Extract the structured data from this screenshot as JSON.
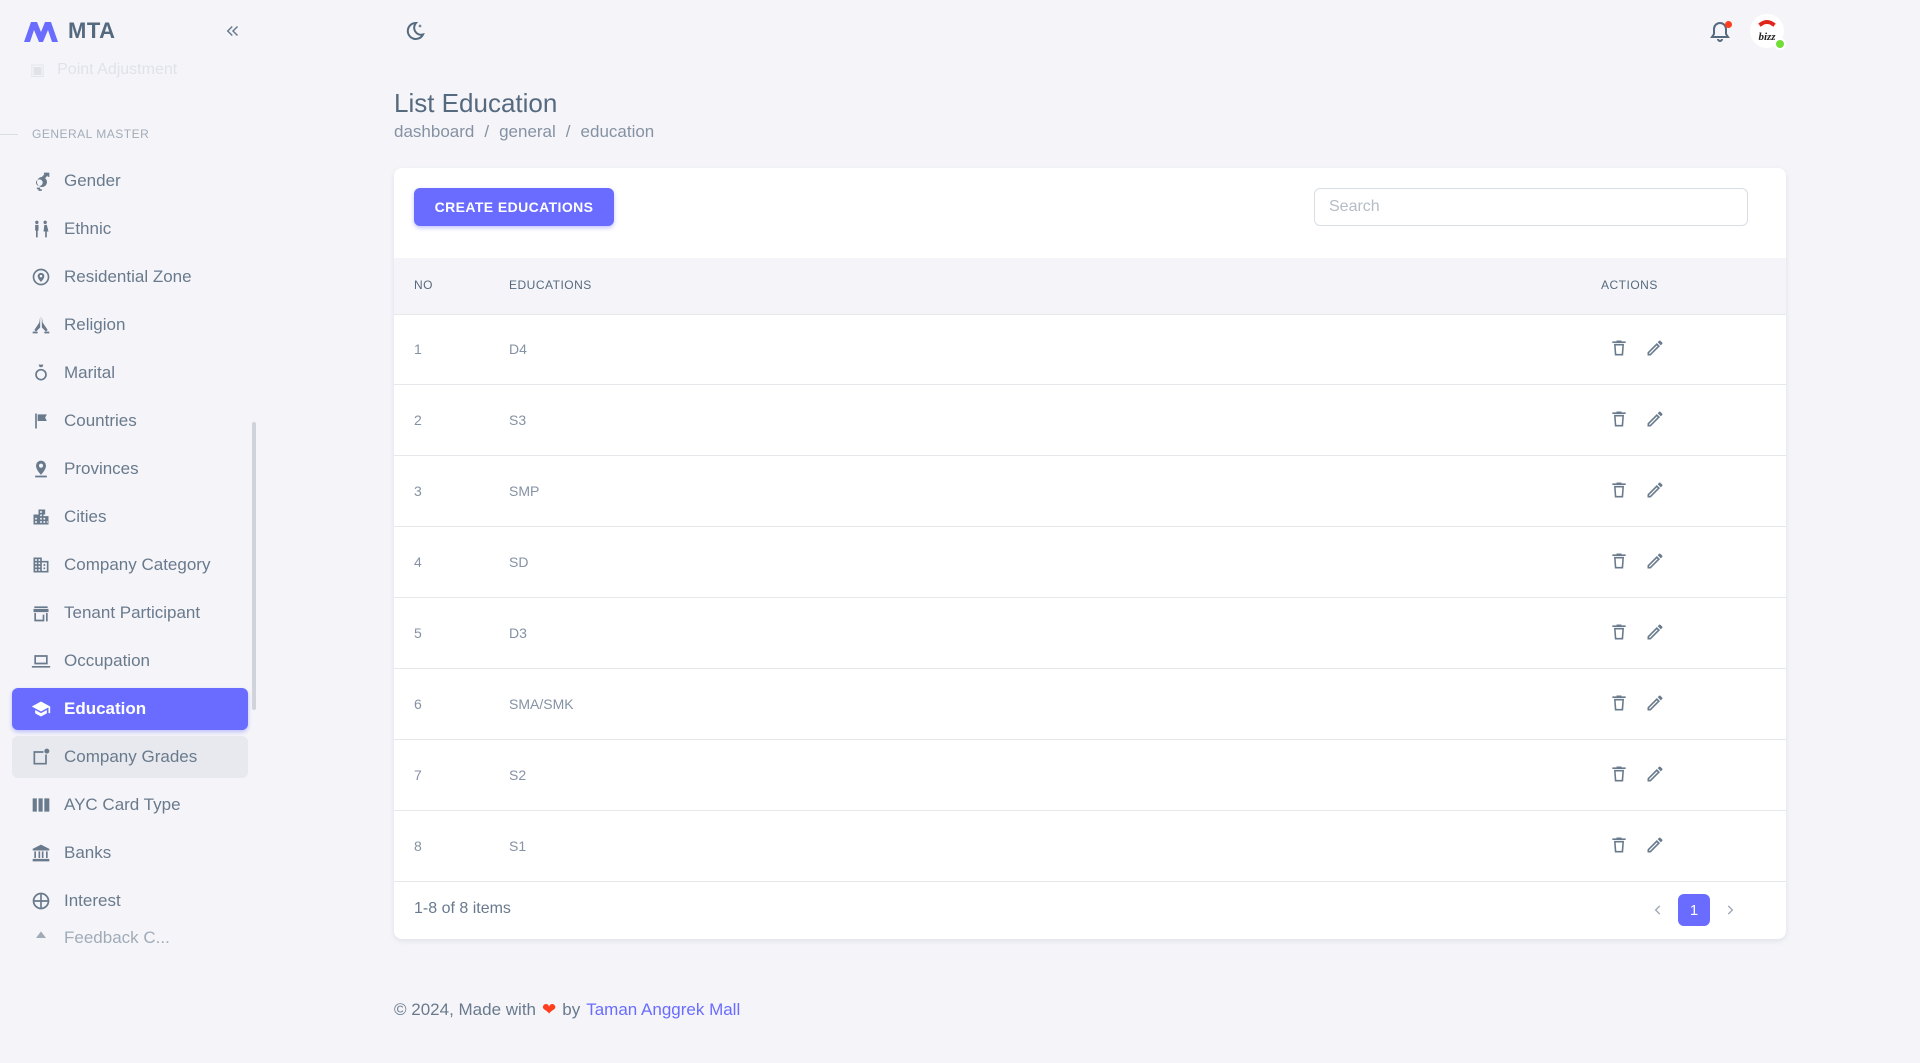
{
  "app": {
    "name": "MTA",
    "brand_color": "#696cff"
  },
  "sidebar": {
    "faded_item": "Point Adjustment",
    "section": "GENERAL MASTER",
    "items": [
      {
        "label": "Gender",
        "icon": "gender-icon"
      },
      {
        "label": "Ethnic",
        "icon": "people-icon"
      },
      {
        "label": "Residential Zone",
        "icon": "map-pin-circle-icon"
      },
      {
        "label": "Religion",
        "icon": "praying-hands-icon"
      },
      {
        "label": "Marital",
        "icon": "ring-icon"
      },
      {
        "label": "Countries",
        "icon": "flag-icon"
      },
      {
        "label": "Provinces",
        "icon": "location-pin-icon"
      },
      {
        "label": "Cities",
        "icon": "city-icon"
      },
      {
        "label": "Company Category",
        "icon": "building-icon"
      },
      {
        "label": "Tenant Participant",
        "icon": "store-icon"
      },
      {
        "label": "Occupation",
        "icon": "laptop-icon"
      },
      {
        "label": "Education",
        "icon": "graduation-cap-icon",
        "active": true
      },
      {
        "label": "Company Grades",
        "icon": "badge-notification-icon"
      },
      {
        "label": "AYC Card Type",
        "icon": "cards-icon"
      },
      {
        "label": "Banks",
        "icon": "bank-icon"
      },
      {
        "label": "Interest",
        "icon": "basketball-icon"
      }
    ],
    "cut_item": "Feedback C..."
  },
  "topbar": {
    "theme_icon": "moon-icon",
    "bell_icon": "bell-icon",
    "avatar_text": "bizz"
  },
  "page": {
    "title": "List Education",
    "breadcrumb": [
      "dashboard",
      "general",
      "education"
    ]
  },
  "card": {
    "create_label": "CREATE EDUCATIONS",
    "search_placeholder": "Search",
    "columns": {
      "no": "NO",
      "educations": "EDUCATIONS",
      "actions": "ACTIONS"
    },
    "rows": [
      {
        "no": "1",
        "education": "D4"
      },
      {
        "no": "2",
        "education": "S3"
      },
      {
        "no": "3",
        "education": "SMP"
      },
      {
        "no": "4",
        "education": "SD"
      },
      {
        "no": "5",
        "education": "D3"
      },
      {
        "no": "6",
        "education": "SMA/SMK"
      },
      {
        "no": "7",
        "education": "S2"
      },
      {
        "no": "8",
        "education": "S1"
      }
    ],
    "info": "1-8 of 8 items",
    "current_page": "1"
  },
  "footer": {
    "prefix": "© 2024, Made with",
    "by": "by",
    "link": "Taman Anggrek Mall"
  }
}
